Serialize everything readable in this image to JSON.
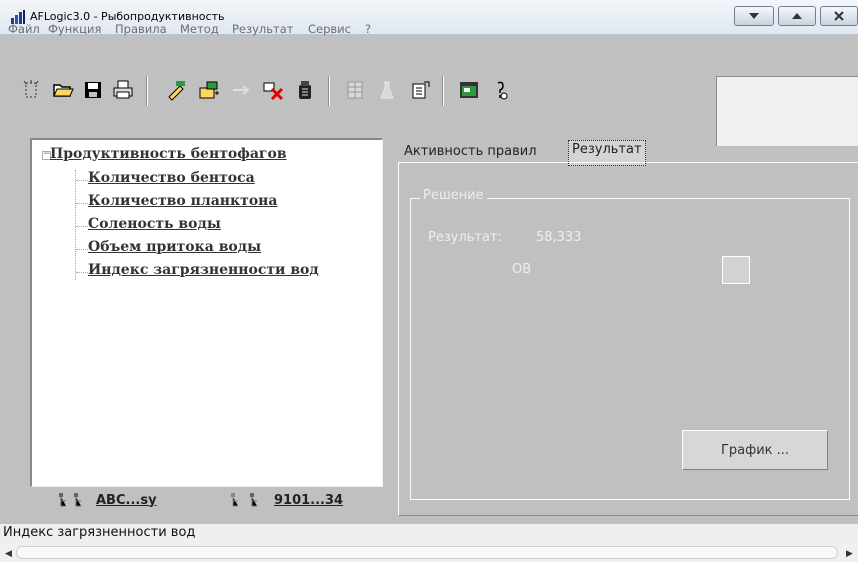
{
  "window": {
    "title": "AFLogic3.0 - Рыбопродуктивность",
    "accent": "#c7d4e3"
  },
  "menu": [
    "Файл",
    "Функция",
    "Правила",
    "Метод",
    "Результат",
    "Сервис",
    "?"
  ],
  "toolbar": {
    "icons": [
      "new-icon",
      "open-folder-icon",
      "save-icon",
      "print-icon",
      "edit-icon",
      "add-rule-icon",
      "arrow-icon",
      "delete-icon",
      "calculate-icon",
      "table-icon",
      "flask-icon",
      "export-icon",
      "window-icon",
      "help-icon"
    ]
  },
  "tree": {
    "root": "Продуктивность бентофагов",
    "children": [
      "Количество бентоса",
      "Количество планктона",
      "Соленость воды",
      "Объем притока воды",
      "Индекс загрязненности вод"
    ]
  },
  "bottom_tabs": [
    "ABC...sy",
    "9101...34"
  ],
  "tabs": {
    "activity": "Активность правил",
    "result": "Результат"
  },
  "solution": {
    "title": "Решение",
    "result_label": "Результат:",
    "result_value": "58,333",
    "ob_label": "OB"
  },
  "buttons": {
    "graph": "График ..."
  },
  "status": {
    "text": "Индекс загрязненности вод"
  }
}
